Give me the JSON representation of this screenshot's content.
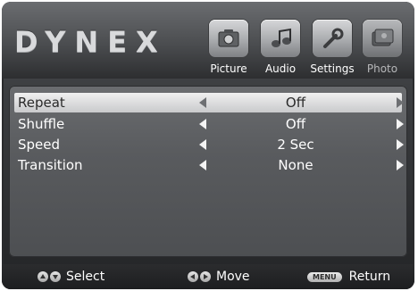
{
  "brand": {
    "logo_text": "DYNEX"
  },
  "tabs": [
    {
      "label": "Picture",
      "icon": "picture-icon",
      "state": "active"
    },
    {
      "label": "Audio",
      "icon": "audio-icon",
      "state": "active"
    },
    {
      "label": "Settings",
      "icon": "settings-icon",
      "state": "active"
    },
    {
      "label": "Photo",
      "icon": "photo-icon",
      "state": "dim"
    }
  ],
  "menu": {
    "rows": [
      {
        "label": "Repeat",
        "value": "Off",
        "selected": true
      },
      {
        "label": "Shuffle",
        "value": "Off",
        "selected": false
      },
      {
        "label": "Speed",
        "value": "2 Sec",
        "selected": false
      },
      {
        "label": "Transition",
        "value": "None",
        "selected": false
      }
    ]
  },
  "footer": {
    "select_label": "Select",
    "move_label": "Move",
    "menu_key_label": "MENU",
    "return_label": "Return"
  },
  "colors": {
    "selected_row": "#e6e6e6",
    "panel": "#5c5e61",
    "text": "#ffffff"
  }
}
